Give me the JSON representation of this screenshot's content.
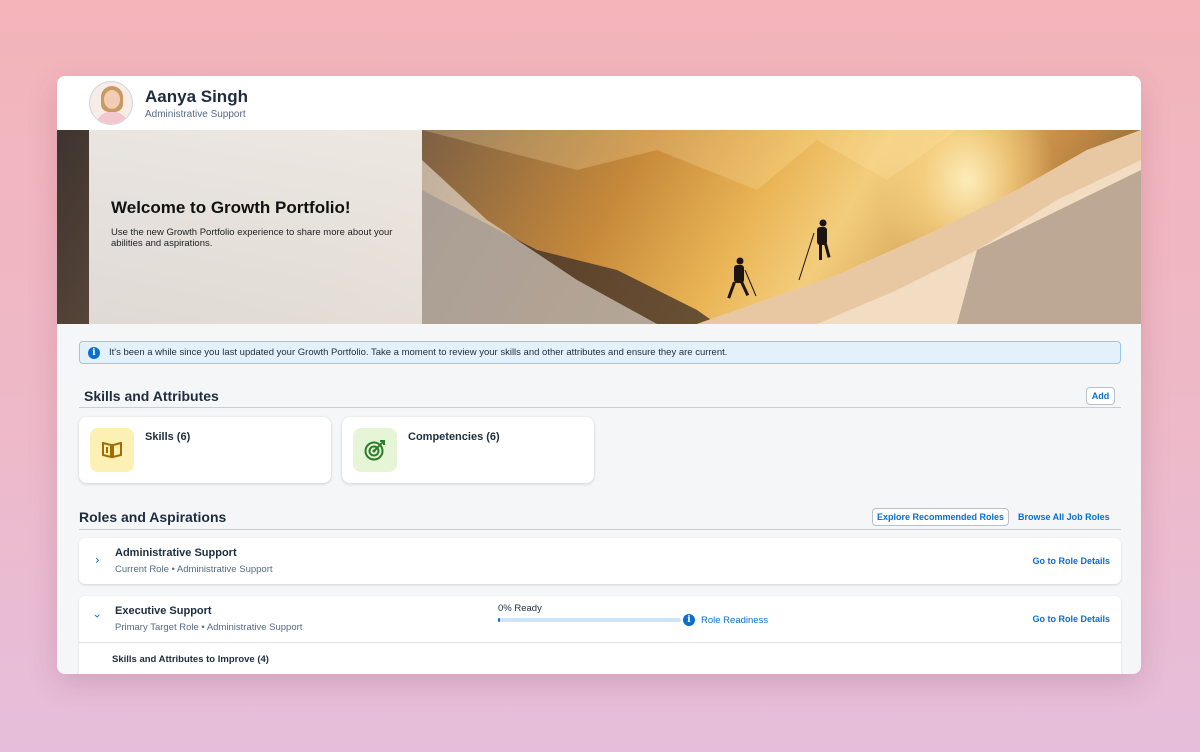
{
  "profile": {
    "name": "Aanya Singh",
    "role": "Administrative Support"
  },
  "banner": {
    "title": "Welcome to Growth Portfolio!",
    "text": "Use the new Growth Portfolio experience to share more about your abilities and aspirations."
  },
  "alert": {
    "icon": "info-icon",
    "text": "It's been a while since you last updated your Growth Portfolio. Take a moment to review your skills and other attributes and ensure they are current."
  },
  "skills_section": {
    "title": "Skills and Attributes",
    "add_label": "Add",
    "cards": [
      {
        "label": "Skills (6)",
        "icon": "book-icon",
        "icon_bg": "#fdf0b4",
        "icon_color": "#a26c00"
      },
      {
        "label": "Competencies (6)",
        "icon": "target-icon",
        "icon_bg": "#e5f5d6",
        "icon_color": "#2b7c2b"
      }
    ]
  },
  "roles_section": {
    "title": "Roles and Aspirations",
    "explore_label": "Explore Recommended Roles",
    "browse_label": "Browse All Job Roles",
    "roles": [
      {
        "title": "Administrative Support",
        "subtitle": "Current Role • Administrative Support",
        "link": "Go to Role Details",
        "expanded": false
      },
      {
        "title": "Executive Support",
        "subtitle": "Primary Target Role • Administrative Support",
        "link": "Go to Role Details",
        "expanded": true,
        "readiness_label": "0% Ready",
        "readiness_value": 0,
        "readiness_link": "Role Readiness",
        "improve_title": "Skills and Attributes to Improve (4)"
      }
    ]
  },
  "colors": {
    "accent": "#0a6ed1",
    "text": "#1d2d3e",
    "alert_bg": "#e3f1fb"
  }
}
